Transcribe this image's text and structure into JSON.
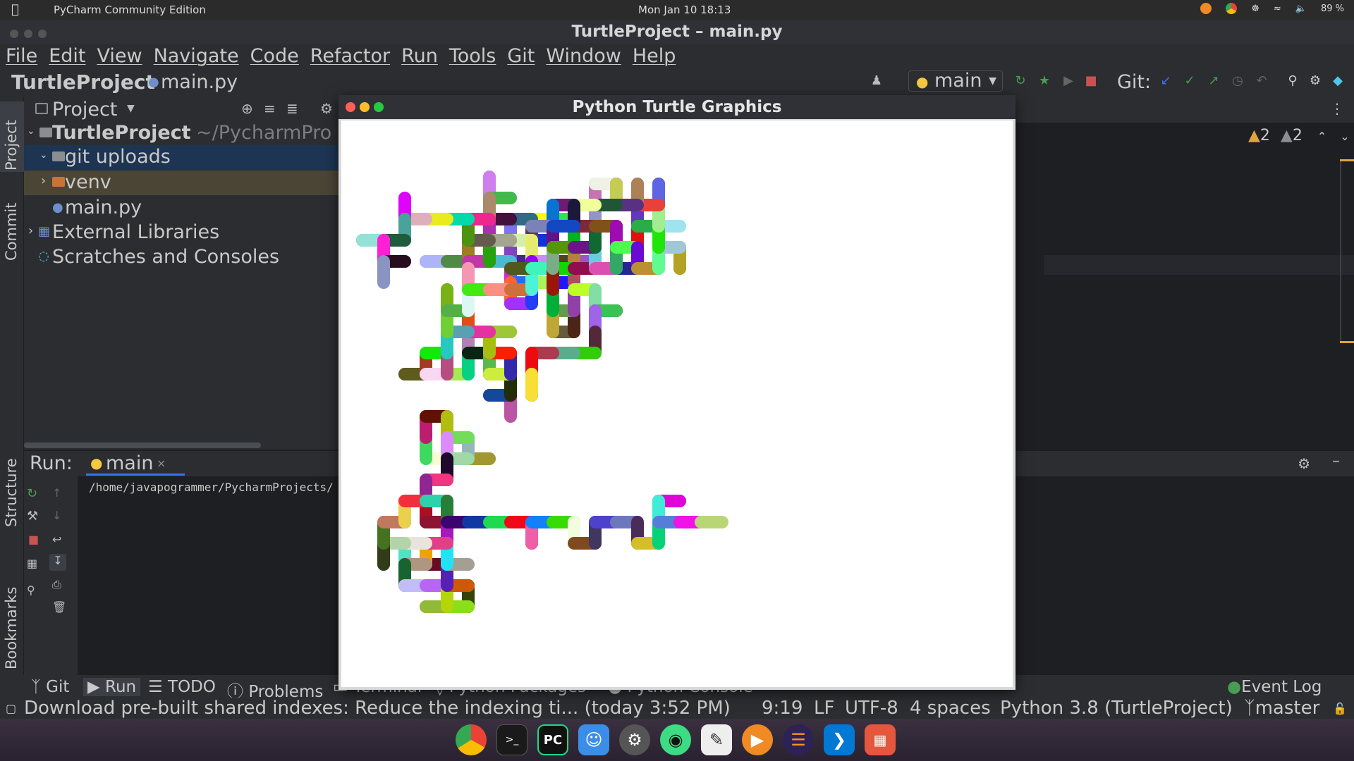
{
  "system_bar": {
    "app_name": "PyCharm Community Edition",
    "clock": "Mon Jan 10  18:13",
    "battery": "89 %"
  },
  "ide": {
    "window_title": "TurtleProject – main.py",
    "menu": [
      "File",
      "Edit",
      "View",
      "Navigate",
      "Code",
      "Refactor",
      "Run",
      "Tools",
      "Git",
      "Window",
      "Help"
    ],
    "breadcrumb_project": "TurtleProject",
    "breadcrumb_file": "main.py",
    "run_config": "main",
    "git_label": "Git:",
    "warnings_a": "2",
    "warnings_b": "2"
  },
  "left_strip": {
    "project_tab": "Project",
    "commit_tab": "Commit",
    "structure_tab": "Structure",
    "bookmarks_tab": "Bookmarks"
  },
  "project_panel": {
    "title": "Project",
    "tree": [
      {
        "label": "TurtleProject",
        "suffix": "~/PycharmPro"
      },
      {
        "label": "git uploads"
      },
      {
        "label": "venv"
      },
      {
        "label": "main.py"
      },
      {
        "label": "External Libraries"
      },
      {
        "label": "Scratches and Consoles"
      }
    ]
  },
  "run_panel": {
    "label": "Run:",
    "tab": "main",
    "output_path": "/home/javapogrammer/PycharmProjects/"
  },
  "bottom_tabs": {
    "git": "Git",
    "run": "Run",
    "todo": "TODO",
    "problems": "Problems",
    "terminal": "Terminal",
    "python_packages": "Python Packages",
    "python_console": "Python Console",
    "event_log": "Event Log"
  },
  "status_bar": {
    "message": "Download pre-built shared indexes: Reduce the indexing ti... (today 3:52 PM)",
    "position": "9:19",
    "line_sep": "LF",
    "encoding": "UTF-8",
    "indent": "4 spaces",
    "interpreter": "Python 3.8 (TurtleProject)",
    "branch": "master"
  },
  "turtle_window": {
    "title": "Python Turtle Graphics"
  },
  "colors": {
    "accent_blue": "#3574f0",
    "run_green": "#499c54",
    "stop_red": "#c75450",
    "warning_yellow": "#e0a43a"
  },
  "dock_icons": [
    "chrome-icon",
    "terminal-icon",
    "pycharm-icon",
    "finder-icon",
    "settings-icon",
    "android-icon",
    "notes-icon",
    "vlc-icon",
    "eclipse-icon",
    "vscode-icon",
    "apps-grid-icon"
  ]
}
